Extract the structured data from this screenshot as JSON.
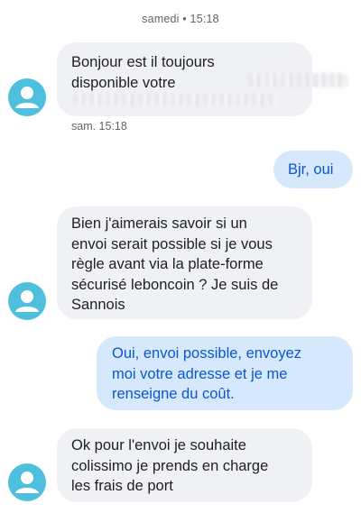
{
  "conversation": {
    "date_header": "samedi • 15:18",
    "messages": [
      {
        "direction": "incoming",
        "lines": [
          "Bonjour est il toujours",
          "disponible votre"
        ],
        "timestamp": "sam. 15:18"
      },
      {
        "direction": "outgoing",
        "lines": [
          "Bjr, oui"
        ]
      },
      {
        "direction": "incoming",
        "lines": [
          "Bien j'aimerais savoir si un",
          "envoi serait possible si je vous",
          "règle avant via la plate-forme",
          "sécurisé leboncoin ? Je suis de",
          "Sannois"
        ]
      },
      {
        "direction": "outgoing",
        "lines": [
          "Oui, envoi possible, envoyez",
          "moi votre adresse et je me",
          "renseigne du coût."
        ]
      },
      {
        "direction": "incoming",
        "lines": [
          "Ok pour l'envoi je souhaite",
          "colissimo je prends en charge",
          "les frais de port"
        ]
      }
    ]
  },
  "colors": {
    "incoming_bubble": "#f0f1f4",
    "outgoing_bubble": "#d6e8fb",
    "outgoing_text": "#0b57d0",
    "avatar": "#4ec0dd"
  },
  "icons": {
    "avatar": "person-icon"
  }
}
